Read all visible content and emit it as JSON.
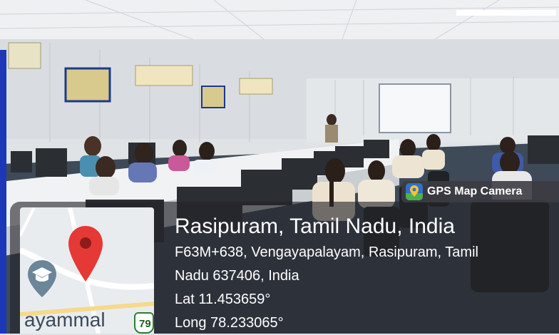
{
  "badge": {
    "label": "GPS Map Camera",
    "icon": "gps-map-camera-icon",
    "color": "#2f6fcf"
  },
  "location": {
    "title": "Rasipuram, Tamil Nadu, India",
    "address_line1": "F63M+638, Vengayapalayam, Rasipuram, Tamil",
    "address_line2": "Nadu 637406, India",
    "lat": "Lat 11.453659°",
    "long": "Long 78.233065°"
  },
  "map": {
    "place_label": "ayammal",
    "road_number": "79",
    "pin_color": "#e53935",
    "poi_icon": "graduation-cap-icon"
  },
  "colors": {
    "accent_bar": "#1c37b8",
    "overlay": "rgba(35,35,40,0.62)"
  }
}
